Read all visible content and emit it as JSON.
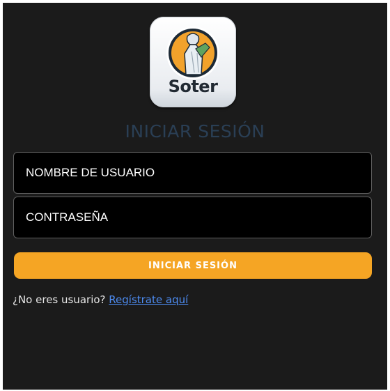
{
  "logo": {
    "text": "Soter"
  },
  "login": {
    "title": "INICIAR SESIÓN",
    "username_placeholder": "NOMBRE DE USUARIO",
    "password_placeholder": "CONTRASEÑA",
    "submit_label": "INICIAR SESIÓN"
  },
  "register": {
    "prompt": "¿No eres usuario?",
    "link_label": "Regístrate aquí"
  },
  "colors": {
    "background": "#1b1b1b",
    "accent": "#f5a524",
    "title": "#2a3f55",
    "link": "#4d8cf2"
  }
}
